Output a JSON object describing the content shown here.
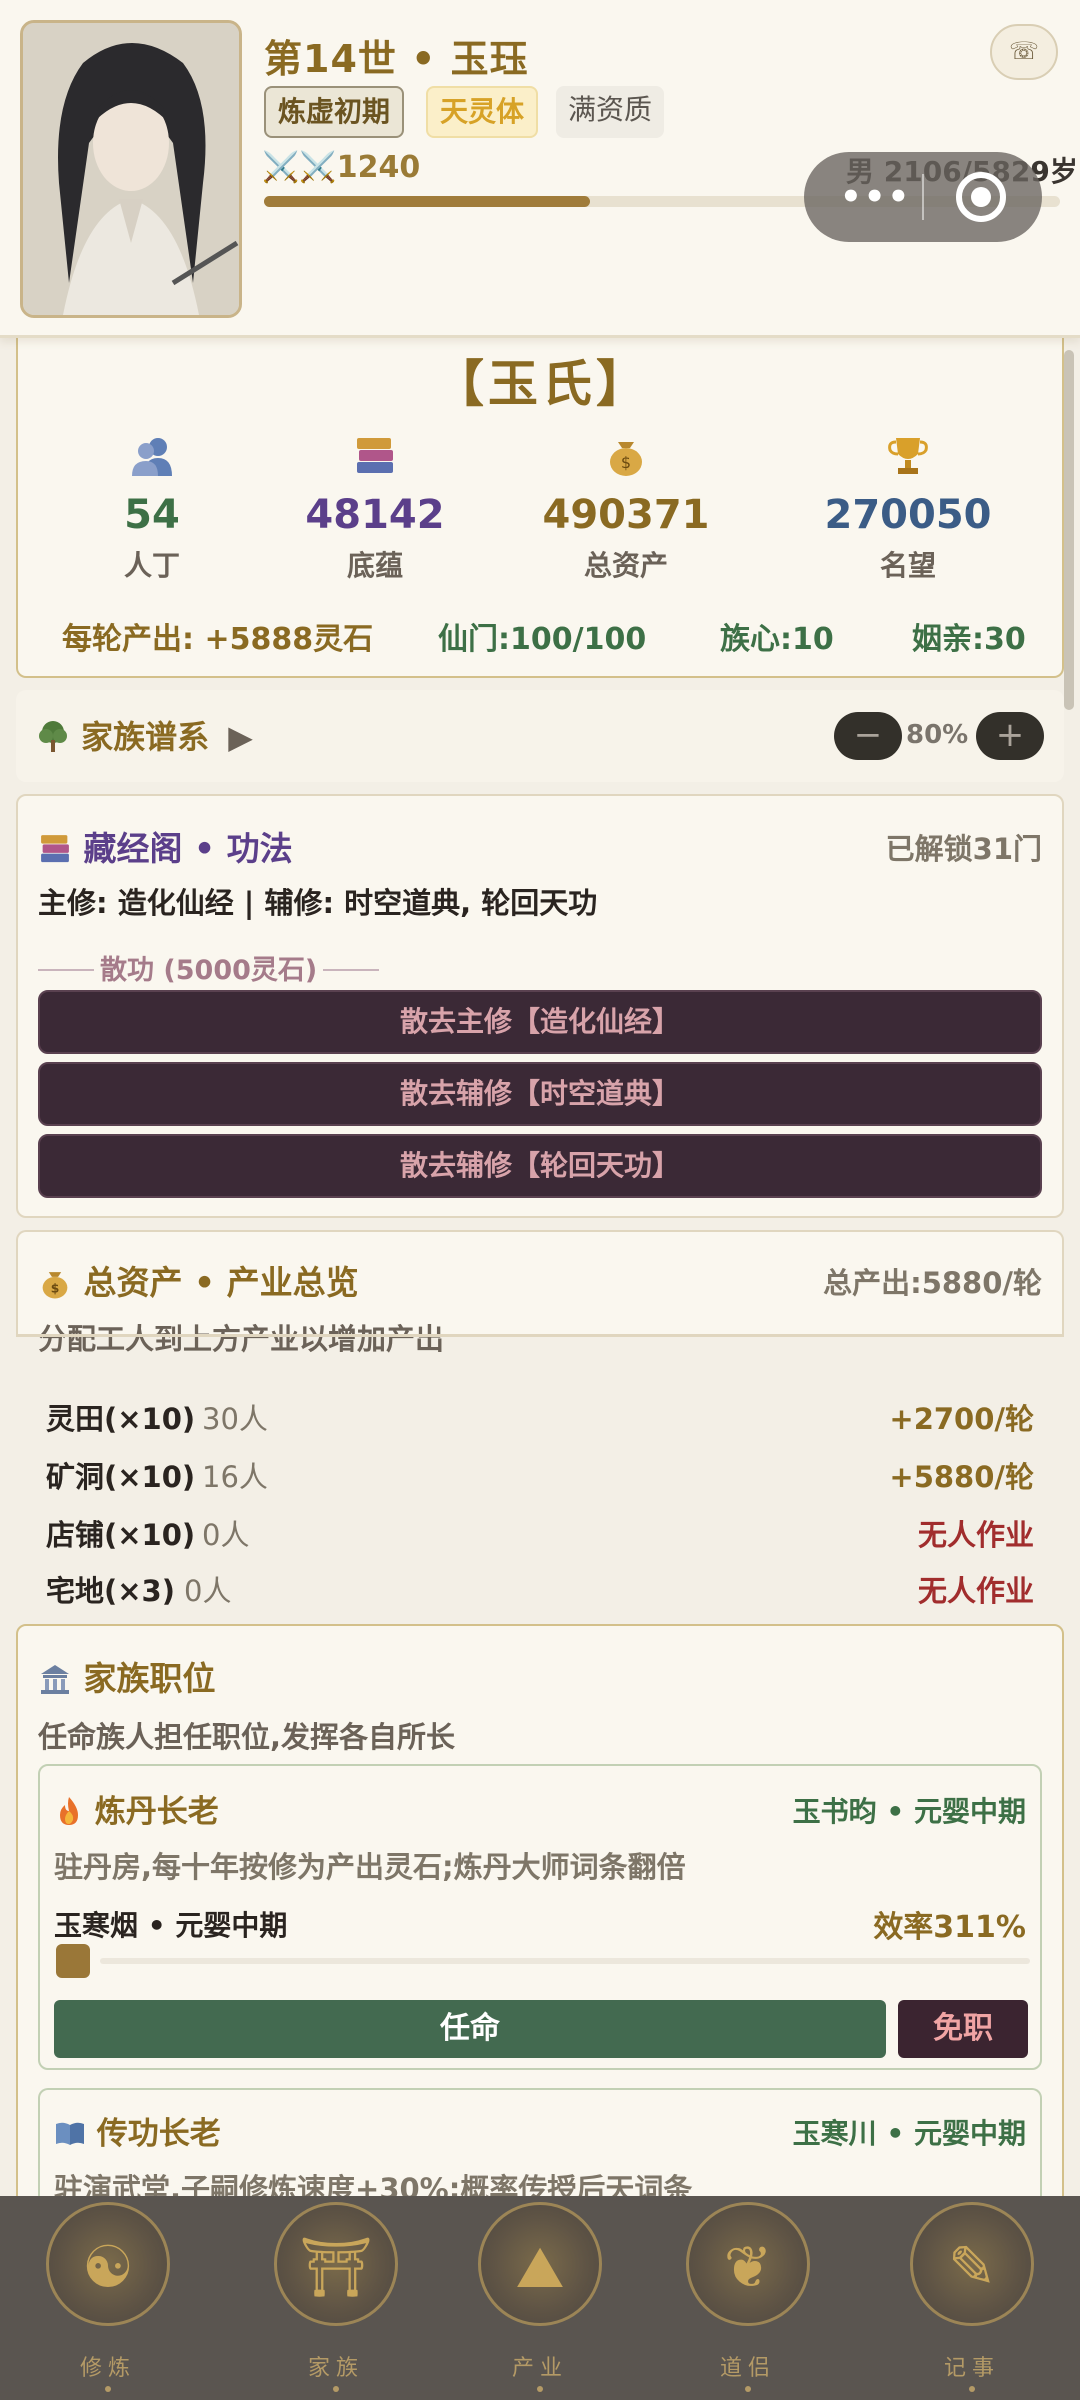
{
  "header": {
    "generation_title": "第14世 • 玉珏",
    "realm_tag": "炼虚初期",
    "body_tag": "天灵体",
    "aptitude_tag": "满资质",
    "power_text": "⚔️⚔️1240",
    "age_text": "男 2106/5829岁",
    "lifespan_progress": 0.41
  },
  "clan": {
    "name": "【玉氏】",
    "stats": [
      {
        "value": "54",
        "label": "人丁",
        "icon": "people-icon",
        "color": "#3d7046"
      },
      {
        "value": "48142",
        "label": "底蕴",
        "icon": "books-icon",
        "color": "#5b3f8a"
      },
      {
        "value": "490371",
        "label": "总资产",
        "icon": "money-bag-icon",
        "color": "#8a6a22"
      },
      {
        "value": "270050",
        "label": "名望",
        "icon": "trophy-icon",
        "color": "#3b5c86"
      }
    ],
    "per_round": "每轮产出: +5888灵石",
    "sect_gate": "仙门:100/100",
    "clan_heart": "族心:10",
    "marriage": "姻亲:30"
  },
  "family_tree": {
    "title": "家族谱系",
    "zoom_out": "−",
    "zoom_level": "80%",
    "zoom_in": "+"
  },
  "library": {
    "title": "藏经阁 • 功法",
    "unlocked": "已解锁31门",
    "main_line": "主修: 造化仙经 | 辅修: 时空道典, 轮回天功",
    "dispel_header": "散功 (5000灵石)",
    "buttons": [
      "散去主修【造化仙经】",
      "散去辅修【时空道典】",
      "散去辅修【轮回天功】"
    ]
  },
  "assets": {
    "title": "总资产 • 产业总览",
    "total_output": "总产出:5880/轮",
    "hint": "分配工人到上方产业以增加产出",
    "industries": [
      {
        "name": "灵田(×10)",
        "workers": "30人",
        "output": "+2700/轮",
        "color": "#8a6a22"
      },
      {
        "name": "矿洞(×10)",
        "workers": "16人",
        "output": "+5880/轮",
        "color": "#8a6a22"
      },
      {
        "name": "店铺(×10)",
        "workers": "0人",
        "output": "无人作业",
        "color": "#a12d2d"
      },
      {
        "name": "宅地(×3)",
        "workers": "0人",
        "output": "无人作业",
        "color": "#a12d2d"
      }
    ]
  },
  "positions": {
    "title": "家族职位",
    "hint": "任命族人担任职位,发挥各自所长",
    "alchemy": {
      "title": "炼丹长老",
      "holder": "玉书昀 • 元婴中期",
      "desc": "驻丹房,每十年按修为产出灵石;炼丹大师词条翻倍",
      "candidate": "玉寒烟 • 元婴中期",
      "efficiency": "效率311%",
      "appoint": "任命",
      "dismiss": "免职"
    },
    "teaching": {
      "title": "传功长老",
      "holder": "玉寒川 • 元婴中期",
      "desc": "驻演武堂,子嗣修炼速度+30%;概率传授后天词条"
    }
  },
  "nav": [
    {
      "label": "修炼",
      "icon": "meditation-icon",
      "glyph": "☯"
    },
    {
      "label": "家族",
      "icon": "pavilion-icon",
      "glyph": "⛩"
    },
    {
      "label": "产业",
      "icon": "mountain-icon",
      "glyph": "⛰"
    },
    {
      "label": "道侣",
      "icon": "couple-icon",
      "glyph": "❦"
    },
    {
      "label": "记事",
      "icon": "scroll-icon",
      "glyph": "✎"
    }
  ]
}
